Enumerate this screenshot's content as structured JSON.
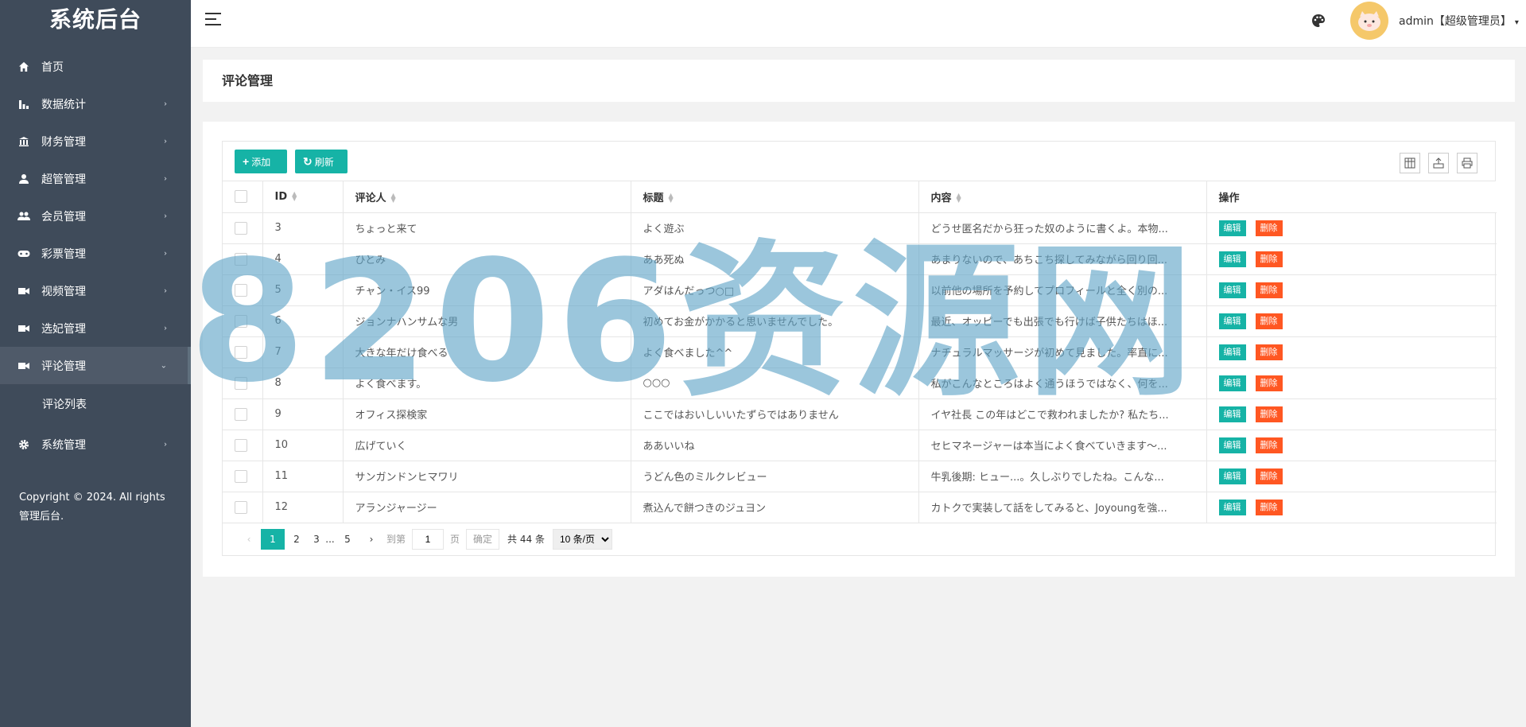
{
  "sidebar": {
    "logo": "系统后台",
    "items": [
      {
        "label": "首页",
        "icon": "home-icon",
        "has_arrow": false
      },
      {
        "label": "数据统计",
        "icon": "bar-chart-icon",
        "has_arrow": true
      },
      {
        "label": "财务管理",
        "icon": "bank-icon",
        "has_arrow": true
      },
      {
        "label": "超管管理",
        "icon": "user-icon",
        "has_arrow": true
      },
      {
        "label": "会员管理",
        "icon": "users-icon",
        "has_arrow": true
      },
      {
        "label": "彩票管理",
        "icon": "gamepad-icon",
        "has_arrow": true
      },
      {
        "label": "视频管理",
        "icon": "video-icon",
        "has_arrow": true
      },
      {
        "label": "选妃管理",
        "icon": "video-icon",
        "has_arrow": true
      },
      {
        "label": "评论管理",
        "icon": "video-icon",
        "has_arrow": true,
        "active": true
      },
      {
        "label": "系统管理",
        "icon": "gear-icon",
        "has_arrow": true
      }
    ],
    "submenu": [
      "评论列表"
    ],
    "copyright": "Copyright © 2024. All rights 管理后台."
  },
  "header": {
    "user": "admin【超级管理员】"
  },
  "page": {
    "title": "评论管理"
  },
  "toolbar": {
    "add_label": "添加",
    "refresh_label": "刷新"
  },
  "table": {
    "columns": [
      "ID",
      "评论人",
      "标题",
      "内容",
      "操作"
    ],
    "edit_label": "编辑",
    "delete_label": "删除",
    "rows": [
      {
        "id": "3",
        "commenter": "ちょっと来て",
        "title": "よく遊ぶ",
        "content": "どうせ匿名だから狂った奴のように書くよ。本物..."
      },
      {
        "id": "4",
        "commenter": "ひとみ",
        "title": "ああ死ぬ",
        "content": "あまりないので、あちこち探してみながら回り回..."
      },
      {
        "id": "5",
        "commenter": "チャン・イス99",
        "title": "アダはんだっつ○□",
        "content": "以前他の場所を予約してプロフィールと全く別の..."
      },
      {
        "id": "6",
        "commenter": "ジョンナハンサムな男",
        "title": "初めてお金がかかると思いませんでした。",
        "content": "最近、オッピーでも出張でも行けば子供たちはほ..."
      },
      {
        "id": "7",
        "commenter": "大きな年だけ食べる",
        "title": "よく食べました^^",
        "content": "ナチュラルマッサージが初めて見ました。率直に..."
      },
      {
        "id": "8",
        "commenter": "よく食べます。",
        "title": "○○○",
        "content": "私がこんなところはよく通うほうではなく、何を..."
      },
      {
        "id": "9",
        "commenter": "オフィス探検家",
        "title": "ここではおいしいいたずらではありません",
        "content": "イヤ社長 この年はどこで救われましたか? 私たち..."
      },
      {
        "id": "10",
        "commenter": "広げていく",
        "title": "ああいいね",
        "content": "セヒマネージャーは本当によく食べていきます〜..."
      },
      {
        "id": "11",
        "commenter": "サンガンドンヒマワリ",
        "title": "うどん色のミルクレビュー",
        "content": "牛乳後期: ヒュー...。久しぶりでしたね。こんな..."
      },
      {
        "id": "12",
        "commenter": "アランジャージー",
        "title": "煮込んで餅つきのジュヨン",
        "content": "カトクで実装して話をしてみると、Joyoungを強..."
      }
    ]
  },
  "pager": {
    "pages": [
      "1",
      "2",
      "3",
      "...",
      "5"
    ],
    "goto_prefix": "到第",
    "goto_value": "1",
    "goto_suffix": "页",
    "confirm_label": "确定",
    "total": "共 44 条",
    "page_size": "10 条/页"
  },
  "watermark": "8206资源网",
  "colors": {
    "sidebar_bg": "#3f4b5a",
    "accent": "#16b3a6",
    "danger": "#ff5722"
  }
}
